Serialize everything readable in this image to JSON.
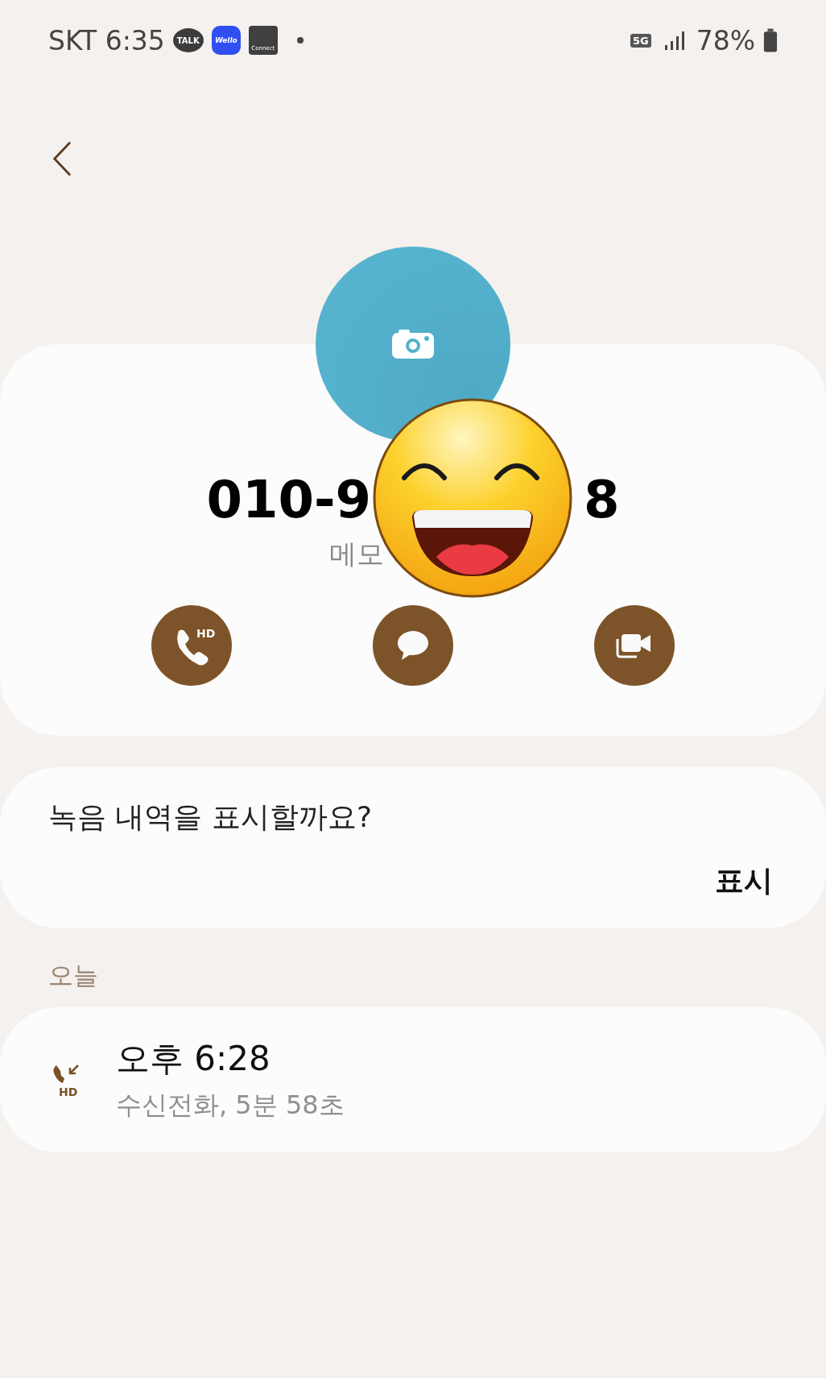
{
  "status_bar": {
    "carrier": "SKT",
    "time": "6:35",
    "notification_icons": [
      {
        "kind": "talk",
        "label": "TALK"
      },
      {
        "kind": "wello",
        "label": "Wello"
      },
      {
        "kind": "connect",
        "label": "Connect"
      },
      {
        "kind": "dot"
      }
    ],
    "network": "5G",
    "battery": "78%"
  },
  "contact": {
    "number_parts": [
      "010-9",
      "8"
    ],
    "memo": "메모",
    "actions": [
      {
        "kind": "hd-call",
        "badge": "HD"
      },
      {
        "kind": "message"
      },
      {
        "kind": "video"
      }
    ],
    "sticker": {
      "kind": "grin"
    }
  },
  "recording_prompt": {
    "question": "녹음 내역을 표시할까요?",
    "button": "표시"
  },
  "section_label": "오늘",
  "calls": [
    {
      "kind": "incoming-hd",
      "badge": "HD",
      "time": "오후 6:28",
      "detail": "수신전화, 5분 58초"
    }
  ]
}
